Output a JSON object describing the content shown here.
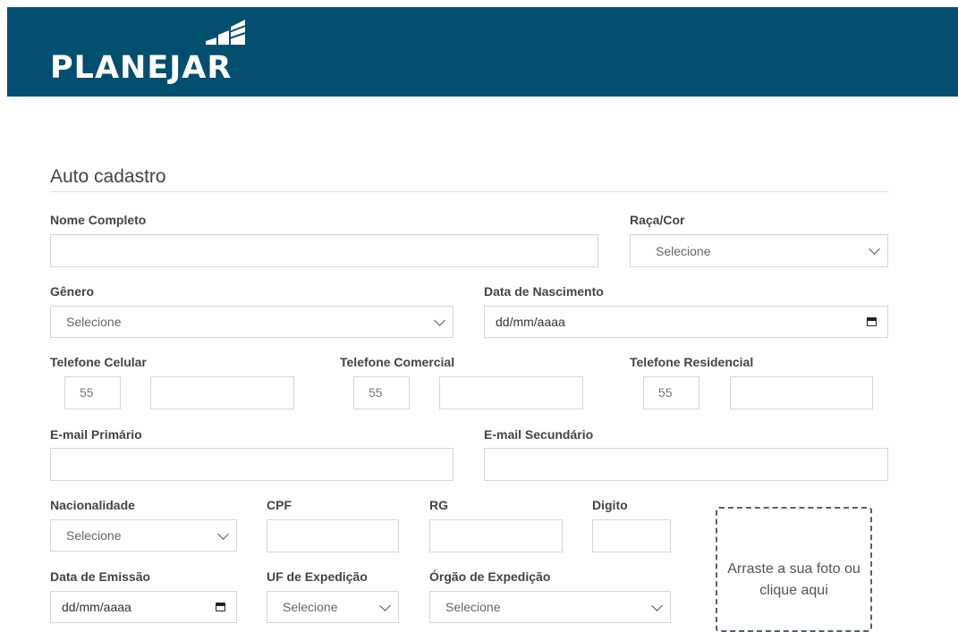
{
  "header": {
    "logo_text": "PLANEJAR",
    "logo_icon": "bar-chart-rising-icon",
    "background": "#034f70"
  },
  "form": {
    "title": "Auto cadastro",
    "nome_completo": {
      "label": "Nome Completo",
      "value": ""
    },
    "raca_cor": {
      "label": "Raça/Cor",
      "value": "Selecione"
    },
    "genero": {
      "label": "Gênero",
      "value": "Selecione"
    },
    "data_nascimento": {
      "label": "Data de Nascimento",
      "value": "dd/mm/aaaa"
    },
    "telefone_celular": {
      "label": "Telefone Celular",
      "ddd": "55",
      "value": ""
    },
    "telefone_comercial": {
      "label": "Telefone Comercial",
      "ddd": "55",
      "value": ""
    },
    "telefone_residencial": {
      "label": "Telefone Residencial",
      "ddd": "55",
      "value": ""
    },
    "email_primario": {
      "label": "E-mail Primário",
      "value": ""
    },
    "email_secundario": {
      "label": "E-mail Secundário",
      "value": ""
    },
    "nacionalidade": {
      "label": "Nacionalidade",
      "value": "Selecione"
    },
    "cpf": {
      "label": "CPF",
      "value": ""
    },
    "rg": {
      "label": "RG",
      "value": ""
    },
    "digito": {
      "label": "Digito",
      "value": ""
    },
    "data_emissao": {
      "label": "Data de Emissão",
      "value": "dd/mm/aaaa"
    },
    "uf_expedicao": {
      "label": "UF de Expedição",
      "value": "Selecione"
    },
    "orgao_expedicao": {
      "label": "Órgão de Expedição",
      "value": "Selecione"
    },
    "photo_dropzone": {
      "text": "Arraste a sua foto ou clique aqui"
    }
  }
}
